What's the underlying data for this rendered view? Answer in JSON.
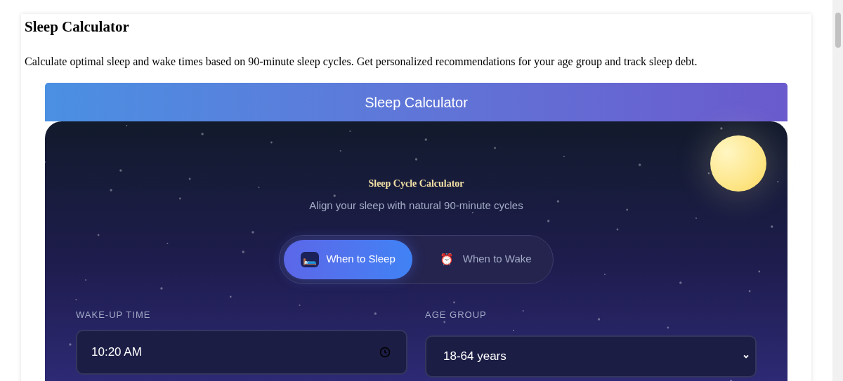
{
  "page": {
    "title": "Sleep Calculator",
    "description": "Calculate optimal sleep and wake times based on 90-minute sleep cycles. Get personalized recommendations for your age group and track sleep debt."
  },
  "widget": {
    "header": "Sleep Calculator",
    "title": "Sleep Cycle Calculator",
    "subtitle": "Align your sleep with natural 90-minute cycles",
    "modes": [
      {
        "icon": "🛏️",
        "label": "When to Sleep",
        "selected": true
      },
      {
        "icon": "⏰",
        "label": "When to Wake",
        "selected": false
      }
    ],
    "time_field": {
      "label": "WAKE-UP TIME",
      "value": "10:20 AM"
    },
    "age_select": {
      "label": "AGE GROUP",
      "value": "18-64 years"
    }
  }
}
